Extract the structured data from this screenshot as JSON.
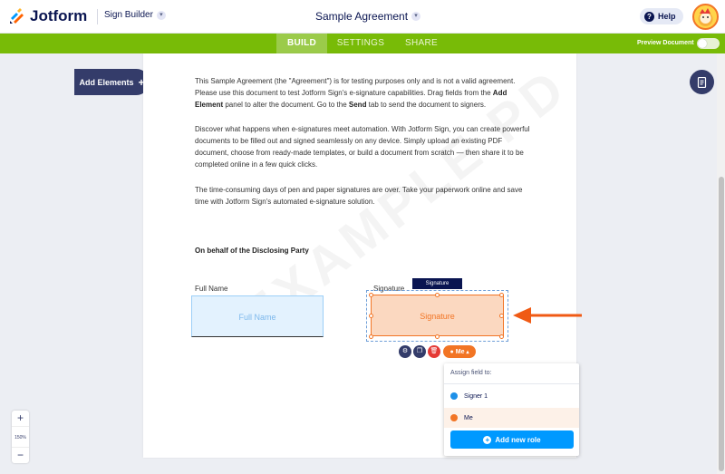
{
  "header": {
    "brand": "Jotform",
    "app_selector": "Sign Builder",
    "doc_title": "Sample Agreement",
    "help": "Help"
  },
  "nav": {
    "tabs": [
      "BUILD",
      "SETTINGS",
      "SHARE"
    ],
    "active_tab": "BUILD",
    "preview_label": "Preview Document",
    "preview_on": false
  },
  "sidebar": {
    "add_elements": "Add Elements",
    "add_symbol": "+"
  },
  "zoom": {
    "plus": "+",
    "value": "150%",
    "minus": "−"
  },
  "document": {
    "watermark": "EXAMPLE PD",
    "p1_a": "This Sample Agreement (the \"Agreement\") is for testing purposes only and is not a valid agreement. Please use this document to test Jotform Sign's e-signature capabilities. Drag fields from the ",
    "p1_b": "Add Element",
    "p1_c": " panel to alter the document. Go to the ",
    "p1_d": "Send",
    "p1_e": " tab to send the document to signers.",
    "p2": "Discover what happens when e-signatures meet automation. With Jotform Sign, you can create powerful documents to be filled out and signed seamlessly on any device. Simply upload an existing PDF document, choose from ready-made templates, or build a document from scratch — then share it to be completed online in a few quick clicks.",
    "p3": "The time-consuming days of pen and paper signatures are over. Take your paperwork online and save time with Jotform Sign's automated e-signature solution.",
    "party_heading": "On behalf of the Disclosing Party",
    "full_name_label": "Full Name",
    "full_name_placeholder": "Full Name",
    "signature_label": "Signature",
    "signature_tag": "Signature",
    "signature_placeholder": "Signature",
    "assignee": "Me"
  },
  "assign_menu": {
    "heading": "Assign field to:",
    "options": [
      {
        "label": "Signer 1",
        "color": "#1e90e8"
      },
      {
        "label": "Me",
        "color": "#f27525"
      }
    ],
    "selected": "Me",
    "add_role": "Add new role"
  },
  "colors": {
    "accent_green": "#78bb07",
    "navy": "#0a1551",
    "orange": "#f27525",
    "blue": "#0099ff"
  },
  "icons": [
    "jotform-logo-icon",
    "chevron-down-icon",
    "help-icon",
    "avatar-icon",
    "document-icon",
    "gear-icon",
    "duplicate-icon",
    "trash-icon",
    "user-icon",
    "plus-icon",
    "arrow-left-icon"
  ]
}
